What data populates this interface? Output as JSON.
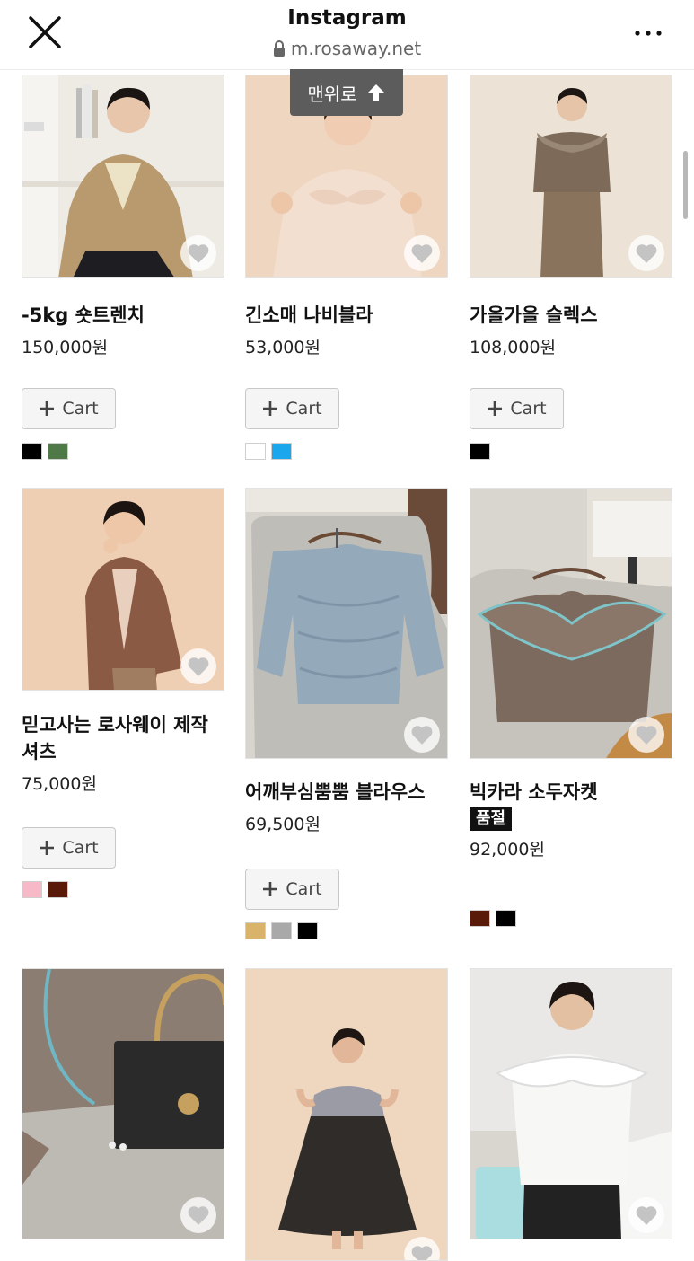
{
  "browser": {
    "title": "Instagram",
    "url": "m.rosaway.net"
  },
  "to_top_label": "맨위로",
  "products": [
    {
      "name": "-5kg 숏트렌치",
      "price": "150,000원",
      "cart_label": "Cart",
      "swatches": [
        "#000000",
        "#4f7a48"
      ]
    },
    {
      "name": "긴소매 나비블라",
      "price": "53,000원",
      "cart_label": "Cart",
      "swatches": [
        "#ffffff",
        "#1aa7ec"
      ]
    },
    {
      "name": "가을가을 슬렉스",
      "price": "108,000원",
      "cart_label": "Cart",
      "swatches": [
        "#000000"
      ]
    },
    {
      "name": "믿고사는 로사웨이 제작 셔츠",
      "price": "75,000원",
      "cart_label": "Cart",
      "swatches": [
        "#f7b8c8",
        "#5a1a0a"
      ]
    },
    {
      "name": "어깨부심뿜뿜 블라우스",
      "price": "69,500원",
      "cart_label": "Cart",
      "swatches": [
        "#d9b36a",
        "#a9a9a9",
        "#000000"
      ]
    },
    {
      "name": "빅카라 소두자켓",
      "badge": "품절",
      "price": "92,000원",
      "swatches": [
        "#5a1a0a",
        "#000000"
      ]
    }
  ]
}
